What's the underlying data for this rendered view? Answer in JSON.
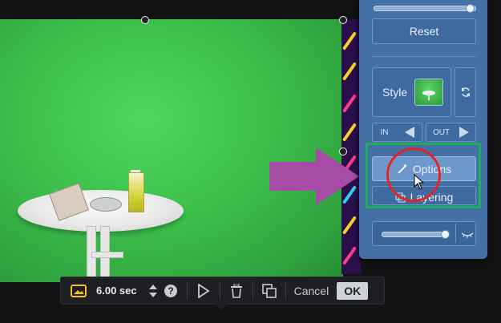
{
  "canvas": {
    "arrow_color": "#a64ca6",
    "background_color": "#3cbf4b"
  },
  "panel": {
    "reset_label": "Reset",
    "style_label": "Style",
    "in_label": "IN",
    "out_label": "OUT",
    "options_label": "Options",
    "layering_label": "Layering",
    "top_slider_value": 1.0,
    "bottom_slider_value": 0.95
  },
  "annotations": {
    "highlight_box_color": "#1bb15a",
    "highlight_circle_color": "#e12424"
  },
  "toolbar": {
    "duration": "6.00 sec",
    "cancel_label": "Cancel",
    "ok_label": "OK",
    "icons": [
      "image-duration-icon",
      "stepper-icon",
      "help-icon",
      "play-icon",
      "trash-icon",
      "duplicate-icon"
    ]
  }
}
